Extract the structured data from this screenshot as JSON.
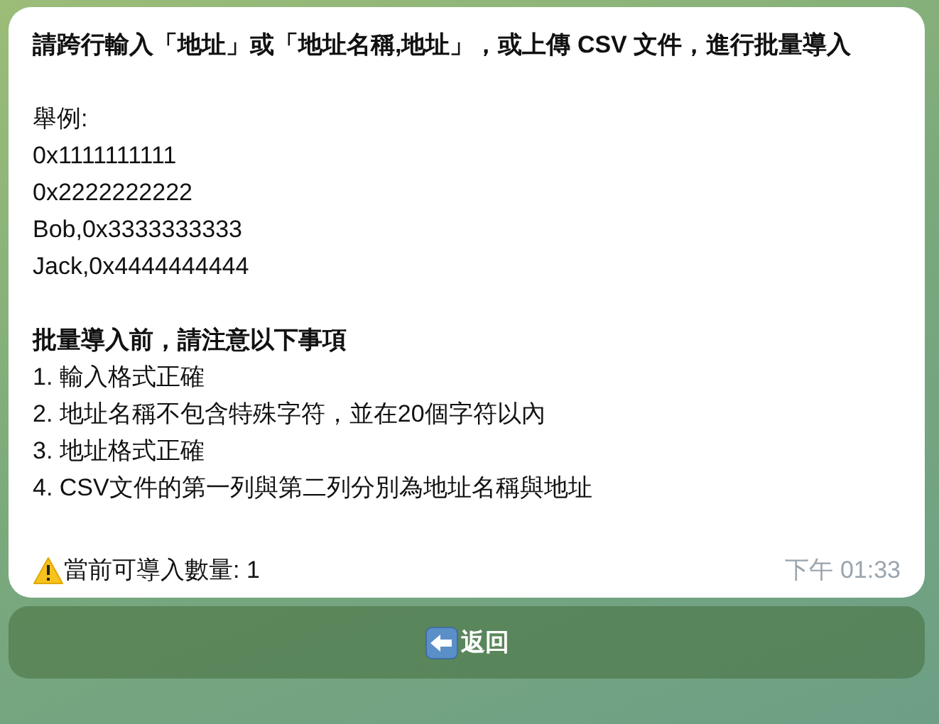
{
  "message": {
    "intro": "請跨行輸入「地址」或「地址名稱,地址」，或上傳 CSV 文件，進行批量導入",
    "example_label": "舉例:",
    "examples": [
      "0x1111111111",
      "0x2222222222",
      "Bob,0x3333333333",
      "Jack,0x4444444444"
    ],
    "notice_title": "批量導入前，請注意以下事項",
    "notices": [
      "1. 輸入格式正確",
      "2. 地址名稱不包含特殊字符，並在20個字符以內",
      "3. 地址格式正確",
      "4. CSV文件的第一列與第二列分別為地址名稱與地址"
    ],
    "status": "當前可導入數量: 1",
    "time": "下午 01:33"
  },
  "buttons": [
    {
      "label": "返回"
    }
  ]
}
